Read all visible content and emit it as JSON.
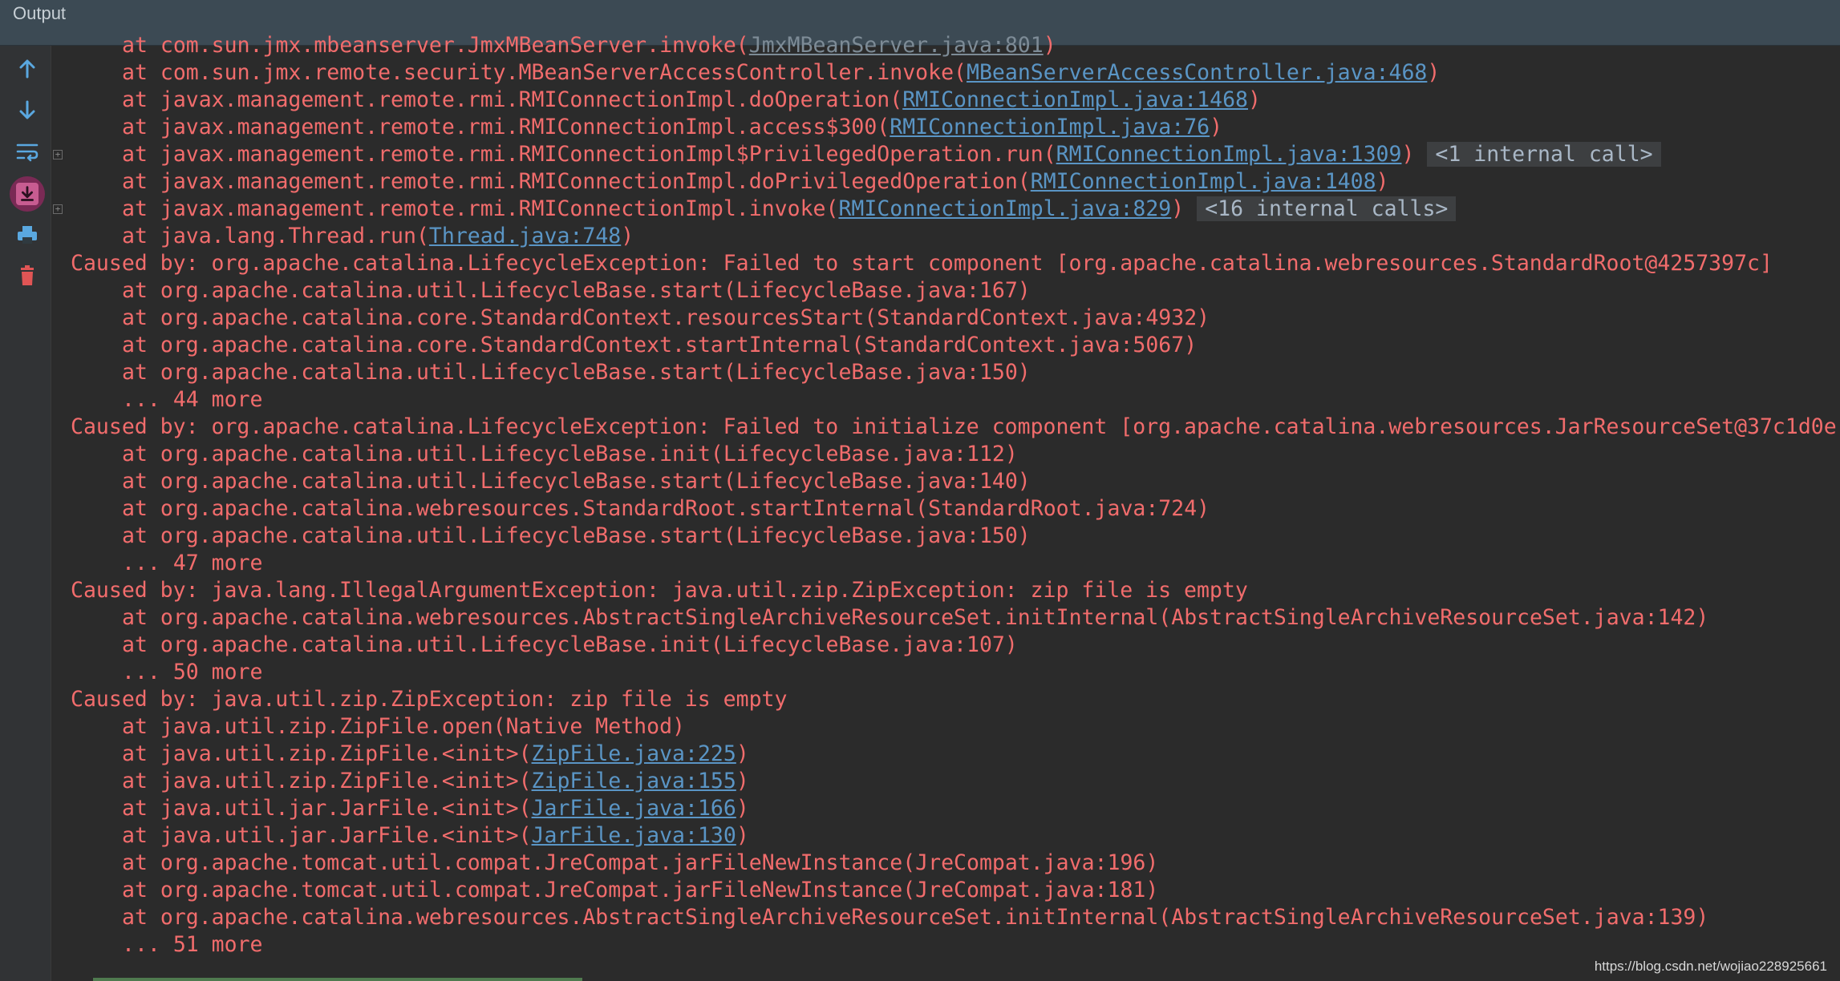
{
  "window": {
    "title": "Output"
  },
  "toolbar": {
    "items": [
      {
        "name": "up-arrow-icon"
      },
      {
        "name": "down-arrow-icon"
      },
      {
        "name": "soft-wrap-icon"
      },
      {
        "name": "scroll-to-end-icon",
        "active": true
      },
      {
        "name": "print-icon"
      },
      {
        "name": "trash-icon"
      }
    ],
    "colors": {
      "icon": "#5aa8e0",
      "trash": "#e05555",
      "active_bg": "#7a2a55"
    }
  },
  "console": {
    "lines": [
      {
        "indent": true,
        "pre": "at com.sun.jmx.mbeanserver.JmxMBeanServer.invoke(",
        "link": "JmxMBeanServer.java:801",
        "post": ")",
        "fold": ""
      },
      {
        "indent": true,
        "pre": "at com.sun.jmx.remote.security.MBeanServerAccessController.invoke(",
        "link": "MBeanServerAccessController.java:468",
        "post": ")",
        "fold": ""
      },
      {
        "indent": true,
        "pre": "at javax.management.remote.rmi.RMIConnectionImpl.doOperation(",
        "link": "RMIConnectionImpl.java:1468",
        "post": ")",
        "fold": ""
      },
      {
        "indent": true,
        "pre": "at javax.management.remote.rmi.RMIConnectionImpl.access$300(",
        "link": "RMIConnectionImpl.java:76",
        "post": ")",
        "fold": ""
      },
      {
        "indent": true,
        "pre": "at javax.management.remote.rmi.RMIConnectionImpl$PrivilegedOperation.run(",
        "link": "RMIConnectionImpl.java:1309",
        "post": ")",
        "fold": "<1 internal call>"
      },
      {
        "indent": true,
        "pre": "at javax.management.remote.rmi.RMIConnectionImpl.doPrivilegedOperation(",
        "link": "RMIConnectionImpl.java:1408",
        "post": ")",
        "fold": ""
      },
      {
        "indent": true,
        "pre": "at javax.management.remote.rmi.RMIConnectionImpl.invoke(",
        "link": "RMIConnectionImpl.java:829",
        "post": ")",
        "fold": "<16 internal calls>"
      },
      {
        "indent": true,
        "pre": "at java.lang.Thread.run(",
        "link": "Thread.java:748",
        "post": ")",
        "fold": ""
      },
      {
        "indent": false,
        "pre": "Caused by: org.apache.catalina.LifecycleException: Failed to start component [org.apache.catalina.webresources.StandardRoot@4257397c]",
        "link": "",
        "post": "",
        "fold": ""
      },
      {
        "indent": true,
        "pre": "at org.apache.catalina.util.LifecycleBase.start(LifecycleBase.java:167)",
        "link": "",
        "post": "",
        "fold": ""
      },
      {
        "indent": true,
        "pre": "at org.apache.catalina.core.StandardContext.resourcesStart(StandardContext.java:4932)",
        "link": "",
        "post": "",
        "fold": ""
      },
      {
        "indent": true,
        "pre": "at org.apache.catalina.core.StandardContext.startInternal(StandardContext.java:5067)",
        "link": "",
        "post": "",
        "fold": ""
      },
      {
        "indent": true,
        "pre": "at org.apache.catalina.util.LifecycleBase.start(LifecycleBase.java:150)",
        "link": "",
        "post": "",
        "fold": ""
      },
      {
        "indent": true,
        "pre": "... 44 more",
        "link": "",
        "post": "",
        "fold": ""
      },
      {
        "indent": false,
        "pre": "Caused by: org.apache.catalina.LifecycleException: Failed to initialize component [org.apache.catalina.webresources.JarResourceSet@37c1d0e",
        "link": "",
        "post": "",
        "fold": ""
      },
      {
        "indent": true,
        "pre": "at org.apache.catalina.util.LifecycleBase.init(LifecycleBase.java:112)",
        "link": "",
        "post": "",
        "fold": ""
      },
      {
        "indent": true,
        "pre": "at org.apache.catalina.util.LifecycleBase.start(LifecycleBase.java:140)",
        "link": "",
        "post": "",
        "fold": ""
      },
      {
        "indent": true,
        "pre": "at org.apache.catalina.webresources.StandardRoot.startInternal(StandardRoot.java:724)",
        "link": "",
        "post": "",
        "fold": ""
      },
      {
        "indent": true,
        "pre": "at org.apache.catalina.util.LifecycleBase.start(LifecycleBase.java:150)",
        "link": "",
        "post": "",
        "fold": ""
      },
      {
        "indent": true,
        "pre": "... 47 more",
        "link": "",
        "post": "",
        "fold": ""
      },
      {
        "indent": false,
        "pre": "Caused by: java.lang.IllegalArgumentException: java.util.zip.ZipException: zip file is empty",
        "link": "",
        "post": "",
        "fold": ""
      },
      {
        "indent": true,
        "pre": "at org.apache.catalina.webresources.AbstractSingleArchiveResourceSet.initInternal(AbstractSingleArchiveResourceSet.java:142)",
        "link": "",
        "post": "",
        "fold": ""
      },
      {
        "indent": true,
        "pre": "at org.apache.catalina.util.LifecycleBase.init(LifecycleBase.java:107)",
        "link": "",
        "post": "",
        "fold": ""
      },
      {
        "indent": true,
        "pre": "... 50 more",
        "link": "",
        "post": "",
        "fold": ""
      },
      {
        "indent": false,
        "pre": "Caused by: java.util.zip.ZipException: zip file is empty",
        "link": "",
        "post": "",
        "fold": ""
      },
      {
        "indent": true,
        "pre": "at java.util.zip.ZipFile.open(Native Method)",
        "link": "",
        "post": "",
        "fold": ""
      },
      {
        "indent": true,
        "pre": "at java.util.zip.ZipFile.<init>(",
        "link": "ZipFile.java:225",
        "post": ")",
        "fold": ""
      },
      {
        "indent": true,
        "pre": "at java.util.zip.ZipFile.<init>(",
        "link": "ZipFile.java:155",
        "post": ")",
        "fold": ""
      },
      {
        "indent": true,
        "pre": "at java.util.jar.JarFile.<init>(",
        "link": "JarFile.java:166",
        "post": ")",
        "fold": ""
      },
      {
        "indent": true,
        "pre": "at java.util.jar.JarFile.<init>(",
        "link": "JarFile.java:130",
        "post": ")",
        "fold": ""
      },
      {
        "indent": true,
        "pre": "at org.apache.tomcat.util.compat.JreCompat.jarFileNewInstance(JreCompat.java:196)",
        "link": "",
        "post": "",
        "fold": ""
      },
      {
        "indent": true,
        "pre": "at org.apache.tomcat.util.compat.JreCompat.jarFileNewInstance(JreCompat.java:181)",
        "link": "",
        "post": "",
        "fold": ""
      },
      {
        "indent": true,
        "pre": "at org.apache.catalina.webresources.AbstractSingleArchiveResourceSet.initInternal(AbstractSingleArchiveResourceSet.java:139)",
        "link": "",
        "post": "",
        "fold": ""
      },
      {
        "indent": true,
        "pre": "... 51 more",
        "link": "",
        "post": "",
        "fold": ""
      }
    ],
    "colors": {
      "error_text": "#f16c6c",
      "link": "#5a95c5",
      "background": "#2b2b2b"
    }
  },
  "watermark": "https://blog.csdn.net/wojiao228925661"
}
